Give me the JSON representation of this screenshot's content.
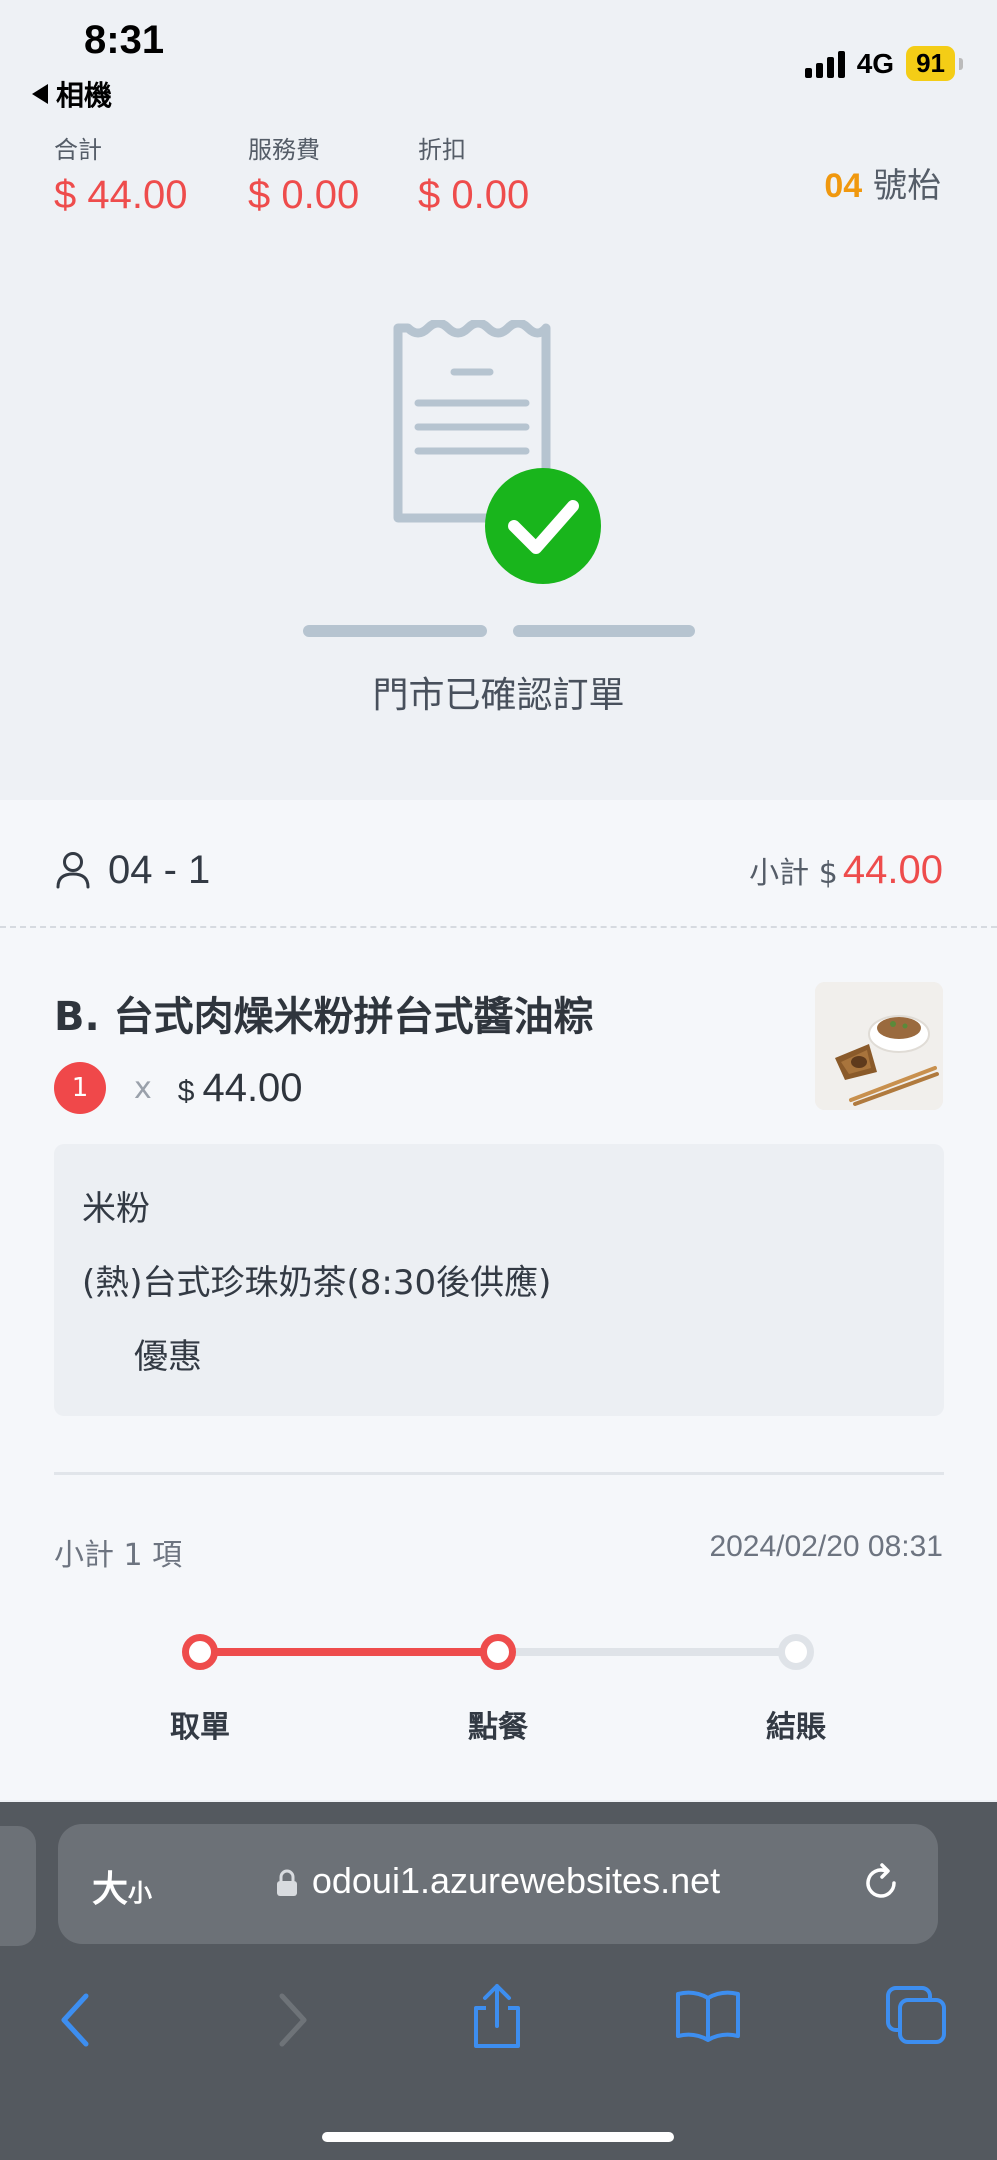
{
  "status_bar": {
    "time": "8:31",
    "back_app": "相機",
    "network": "4G",
    "battery": "91"
  },
  "summary": {
    "total": {
      "label": "合計",
      "value": "$ 44.00"
    },
    "service": {
      "label": "服務費",
      "value": "$ 0.00"
    },
    "discount": {
      "label": "折扣",
      "value": "$ 0.00"
    },
    "table_number": "04",
    "table_suffix": "號枱"
  },
  "confirmation": {
    "text": "門市已確認訂單"
  },
  "order": {
    "guest": "04 - 1",
    "subtotal_label": "小計 $",
    "subtotal_value": "44.00",
    "item": {
      "name": "B. 台式肉燥米粉拼台式醬油粽",
      "quantity": "1",
      "times": "x",
      "currency": "$",
      "price": "44.00",
      "options": [
        "米粉",
        "(熱)台式珍珠奶茶(8:30後供應)",
        "優惠"
      ]
    },
    "footer_count": "小計 1 項",
    "timestamp": "2024/02/20 08:31"
  },
  "progress": {
    "steps": [
      "取單",
      "點餐",
      "結賬"
    ],
    "completed_steps": 2,
    "active_color": "#ee4c4c",
    "inactive_color": "#dfe3e8"
  },
  "browser": {
    "text_size_big": "大",
    "text_size_small": "小",
    "url": "odoui1.azurewebsites.net"
  }
}
